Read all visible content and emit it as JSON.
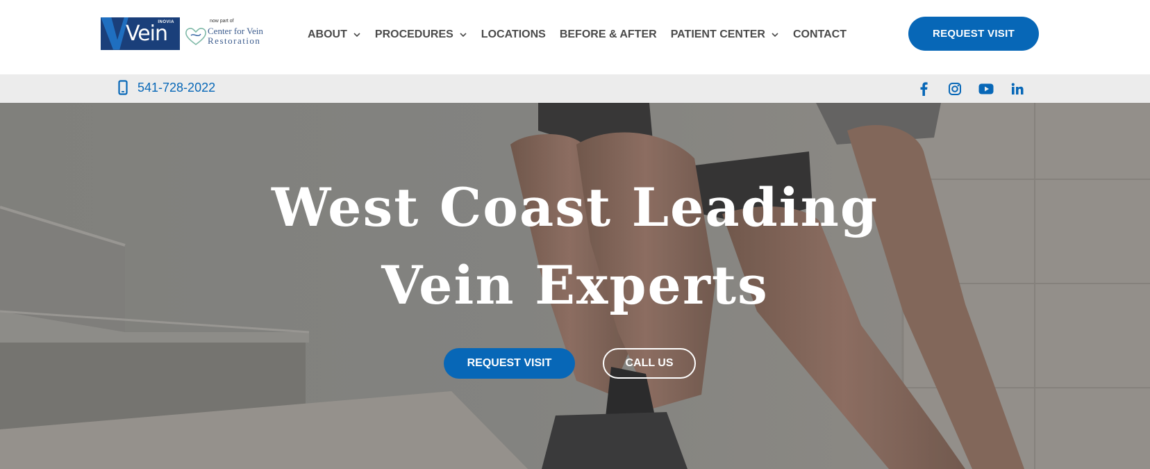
{
  "header": {
    "logo": {
      "brand_small": "INOVIA",
      "brand_word": "Vein",
      "now_part_of": "now part of",
      "partner_line1": "Center for Vein",
      "partner_line2": "Restoration"
    },
    "nav": [
      {
        "label": "ABOUT",
        "dropdown": true
      },
      {
        "label": "PROCEDURES",
        "dropdown": true
      },
      {
        "label": "LOCATIONS",
        "dropdown": false
      },
      {
        "label": "BEFORE & AFTER",
        "dropdown": false
      },
      {
        "label": "PATIENT CENTER",
        "dropdown": true
      },
      {
        "label": "CONTACT",
        "dropdown": false
      }
    ],
    "cta_label": "REQUEST VISIT"
  },
  "topbar": {
    "phone": "541-728-2022",
    "social": [
      "facebook-icon",
      "instagram-icon",
      "youtube-icon",
      "linkedin-icon"
    ]
  },
  "hero": {
    "title_line1": "West Coast Leading",
    "title_line2": "Vein Experts",
    "primary_button": "REQUEST VISIT",
    "secondary_button": "CALL US"
  },
  "colors": {
    "brand_blue": "#0767b7",
    "logo_navy": "#1a3f7a",
    "nav_text": "#4a4a4a",
    "topbar_bg": "#ececec"
  }
}
